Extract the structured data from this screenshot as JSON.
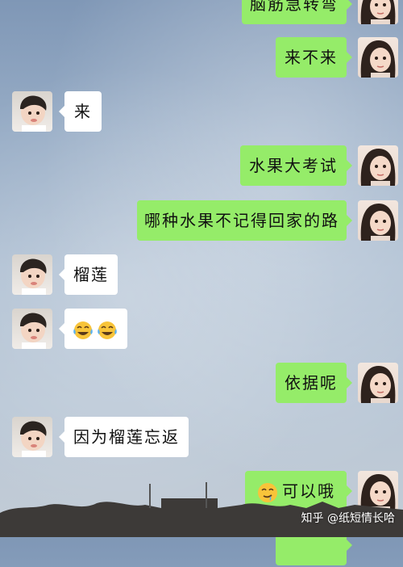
{
  "messages": [
    {
      "side": "right",
      "text": "脑筋急转弯"
    },
    {
      "side": "right",
      "text": "来不来"
    },
    {
      "side": "left",
      "text": "来"
    },
    {
      "side": "right",
      "text": "水果大考试"
    },
    {
      "side": "right",
      "text": "哪种水果不记得回家的路"
    },
    {
      "side": "left",
      "text": "榴莲"
    },
    {
      "side": "left",
      "text": "😂😂"
    },
    {
      "side": "right",
      "text": "依据呢"
    },
    {
      "side": "left",
      "text": "因为榴莲忘返"
    },
    {
      "side": "right",
      "text": "可以哦"
    }
  ],
  "watermark": "知乎 @纸短情长哈",
  "colors": {
    "sent_bubble": "#95ec69",
    "received_bubble": "#ffffff"
  },
  "icons": {
    "emoji_tears_of_joy": "face-with-tears-of-joy-icon",
    "emoji_drooling": "drooling-face-icon"
  }
}
